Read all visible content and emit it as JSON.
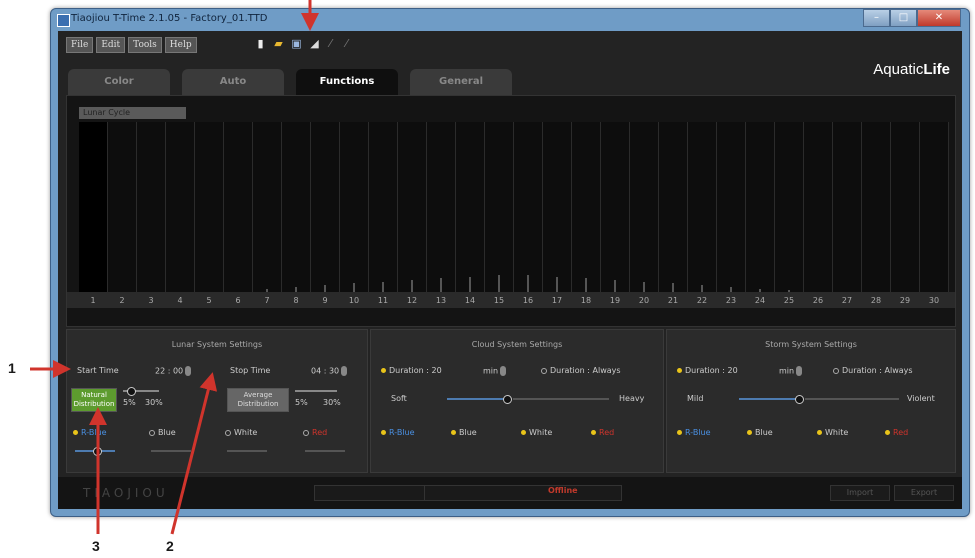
{
  "window": {
    "title": "Tiaojiou T-Time 2.1.05 - Factory_01.TTD",
    "controls": [
      "–",
      "□",
      "✕"
    ]
  },
  "menu": [
    "File",
    "Edit",
    "Tools",
    "Help"
  ],
  "toolbar": {
    "icons": [
      "new-file-icon",
      "open-folder-icon",
      "save-icon",
      "edit-icon",
      "pencil-icon",
      "eraser-icon"
    ]
  },
  "logo": {
    "text_regular": "Aquatic",
    "text_bold": "Life"
  },
  "tabs": [
    "Color",
    "Auto",
    "Functions",
    "General"
  ],
  "active_tab": "Functions",
  "lunar": {
    "label": "Lunar Cycle",
    "days": [
      "1",
      "2",
      "3",
      "4",
      "5",
      "6",
      "7",
      "8",
      "9",
      "10",
      "11",
      "12",
      "13",
      "14",
      "15",
      "16",
      "17",
      "18",
      "19",
      "20",
      "21",
      "22",
      "23",
      "24",
      "25",
      "26",
      "27",
      "28",
      "29",
      "30"
    ],
    "levels": [
      0,
      0,
      0,
      0,
      0,
      0,
      0.02,
      0.03,
      0.04,
      0.05,
      0.06,
      0.07,
      0.08,
      0.09,
      0.1,
      0.1,
      0.09,
      0.08,
      0.07,
      0.06,
      0.05,
      0.04,
      0.03,
      0.02,
      0.01,
      0,
      0,
      0,
      0,
      0
    ]
  },
  "lunar_settings": {
    "title": "Lunar System Settings",
    "start_label": "Start Time",
    "start_value": "22 : 00",
    "stop_label": "Stop Time",
    "stop_value": "04 : 30",
    "natural_btn": "Natural Distribution",
    "average_btn": "Average Distribution",
    "pct_min": "5%",
    "pct_max": "30%",
    "channels": [
      "R-Blue",
      "Blue",
      "White",
      "Red"
    ]
  },
  "cloud_settings": {
    "title": "Cloud System Settings",
    "duration_label": "Duration : 20",
    "unit": "min",
    "always_label": "Duration : Always",
    "soft": "Soft",
    "heavy": "Heavy",
    "channels": [
      "R-Blue",
      "Blue",
      "White",
      "Red"
    ]
  },
  "storm_settings": {
    "title": "Storm System Settings",
    "duration_label": "Duration : 20",
    "unit": "min",
    "always_label": "Duration : Always",
    "mild": "Mild",
    "violent": "Violent",
    "channels": [
      "R-Blue",
      "Blue",
      "White",
      "Red"
    ]
  },
  "status": {
    "brand": "TIAOJIOU",
    "offline": "Offline",
    "import": "Import",
    "export": "Export"
  },
  "annotations": [
    "1",
    "2",
    "3"
  ],
  "colors": {
    "accent_green": "#5d9b2e",
    "dot_yellow": "#e9c41a",
    "offline_red": "#c0392b",
    "rblue": "#4a90e2",
    "red": "#d0342c"
  }
}
